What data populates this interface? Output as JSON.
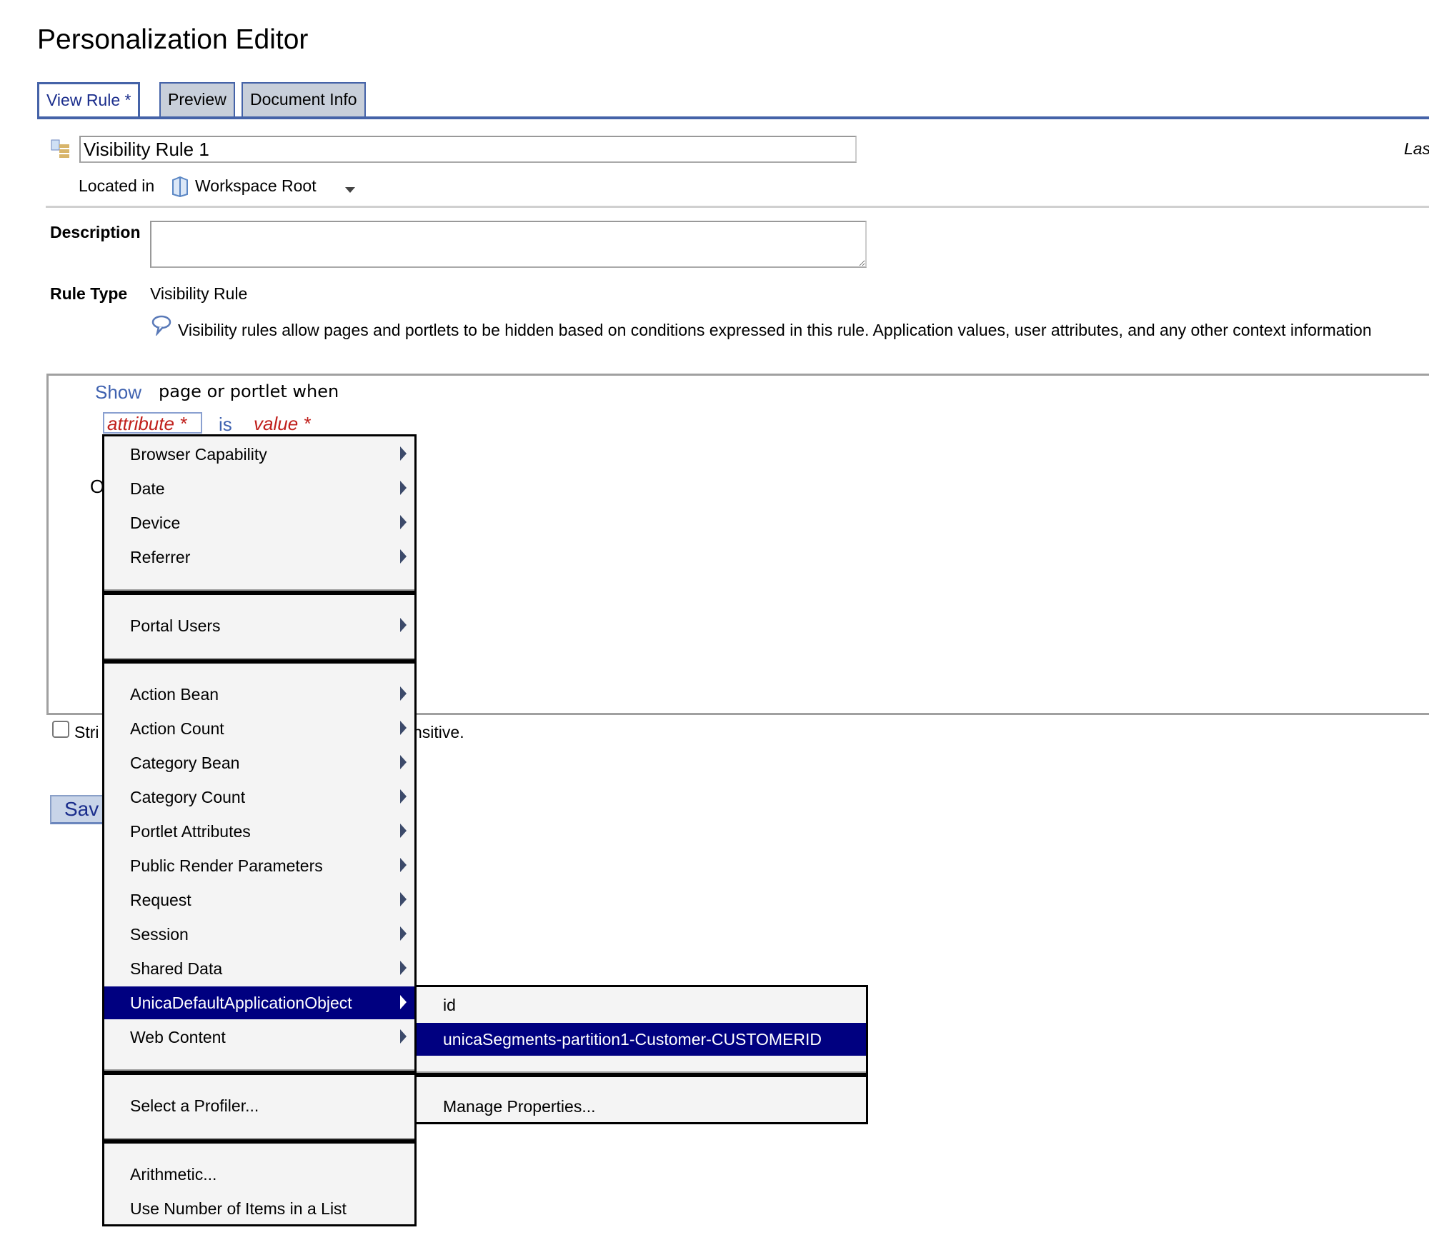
{
  "header": {
    "title": "Personalization Editor"
  },
  "tabs": [
    {
      "label": "View Rule",
      "modified_marker": "*",
      "active": true
    },
    {
      "label": "Preview"
    },
    {
      "label": "Document Info"
    }
  ],
  "rule": {
    "name": "Visibility Rule 1",
    "last_truncated": "Las",
    "located_in_label": "Located in",
    "location": "Workspace Root"
  },
  "description": {
    "label": "Description",
    "value": ""
  },
  "rule_type": {
    "label": "Rule Type",
    "value": "Visibility Rule",
    "help": "Visibility rules allow pages and portlets to be hidden based on conditions expressed in this rule. Application values, user attributes, and any other context information"
  },
  "editor": {
    "show": "Show",
    "page_text": "page or portlet when",
    "attribute": "attribute *",
    "is": "is",
    "value": "value *",
    "hidden_letter": "O",
    "checkbox_label_start": "Stri",
    "checkbox_label_end": "nsitive.",
    "save_partial": "Sav"
  },
  "menu": {
    "groups": [
      [
        "Browser Capability",
        "Date",
        "Device",
        "Referrer"
      ],
      [
        "Portal Users"
      ],
      [
        "Action Bean",
        "Action Count",
        "Category Bean",
        "Category Count",
        "Portlet Attributes",
        "Public Render Parameters",
        "Request",
        "Session",
        "Shared Data",
        "UnicaDefaultApplicationObject",
        "Web Content"
      ],
      [
        "Select a Profiler..."
      ],
      [
        "Arithmetic...",
        "Use Number of Items in a List"
      ]
    ],
    "highlighted": "UnicaDefaultApplicationObject"
  },
  "submenu": {
    "items": [
      "id",
      "unicaSegments-partition1-Customer-CUSTOMERID"
    ],
    "highlighted": "unicaSegments-partition1-Customer-CUSTOMERID",
    "footer": "Manage Properties..."
  },
  "colors": {
    "accent": "#4563a8",
    "tab_bg": "#c8cfda",
    "highlight": "#000080",
    "required": "#c0201c"
  }
}
